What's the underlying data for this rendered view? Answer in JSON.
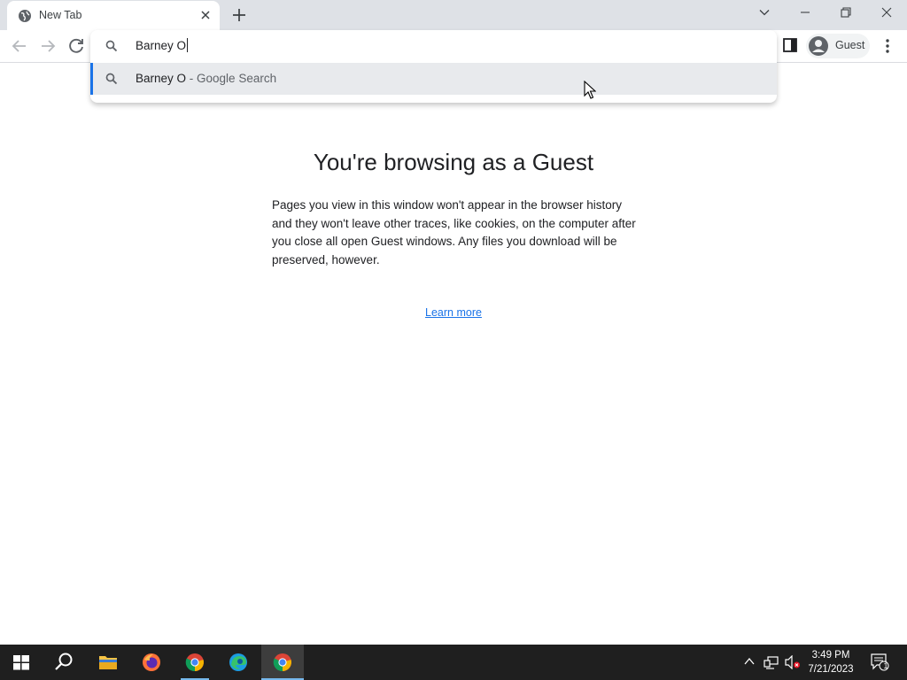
{
  "tab": {
    "title": "New Tab"
  },
  "toolbar": {
    "profile_label": "Guest"
  },
  "omnibox": {
    "input_value": "Barney O",
    "suggestion": {
      "query": "Barney O",
      "separator": " - ",
      "source": "Google Search"
    }
  },
  "page": {
    "heading": "You're browsing as a Guest",
    "body": "Pages you view in this window won't appear in the browser history and they won't leave other traces, like cookies, on the computer after you close all open Guest windows. Any files you download will be preserved, however.",
    "learn_more": "Learn more"
  },
  "taskbar": {
    "time": "3:49 PM",
    "date": "7/21/2023",
    "notification_count": "1",
    "apps": [
      "start",
      "search",
      "file-explorer",
      "firefox",
      "chrome",
      "edge",
      "chrome"
    ]
  },
  "colors": {
    "accent": "#1a73e8",
    "titlebar": "#dee1e6",
    "taskbar": "#1f1f1f"
  }
}
